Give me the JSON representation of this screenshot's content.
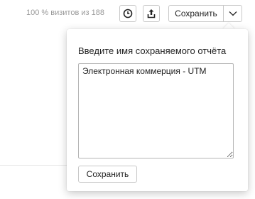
{
  "toolbar": {
    "visits_text": "100 % визитов из 188",
    "history_icon": "clock-icon",
    "export_icon": "share-upload-icon",
    "save_label": "Сохранить",
    "dropdown_icon": "chevron-down-icon"
  },
  "save_popup": {
    "title": "Введите имя сохраняемого отчёта",
    "report_name_value": "Электронная коммерция - UTM",
    "save_label": "Сохранить"
  },
  "colors": {
    "border": "#c8c8c8",
    "muted_text": "#999999",
    "text": "#222222"
  }
}
